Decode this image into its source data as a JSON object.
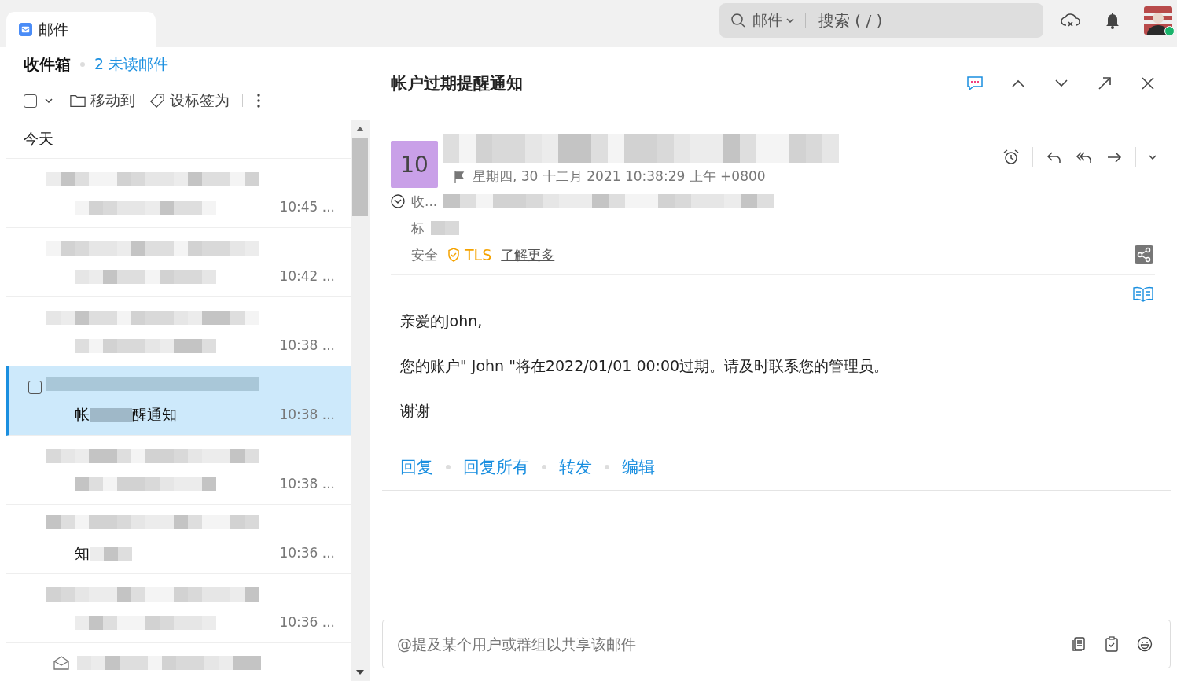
{
  "app_tab": {
    "label": "邮件"
  },
  "search": {
    "scope": "邮件",
    "placeholder": "搜索 ( / )"
  },
  "user": {
    "online": true
  },
  "folder": {
    "title": "收件箱",
    "unread": "2 未读邮件"
  },
  "toolbar": {
    "select_all_checked": false,
    "move": "移动到",
    "tag": "设标签为"
  },
  "list": {
    "group": "今天",
    "rows": [
      {
        "time": "10:45 ...",
        "selected": false,
        "checked": false
      },
      {
        "time": "10:42 ...",
        "selected": false,
        "checked": false
      },
      {
        "time": "10:38 ...",
        "selected": false,
        "checked": false
      },
      {
        "time": "10:38 ...",
        "selected": true,
        "checked": false,
        "fragments": [
          "帐",
          "醒通知"
        ]
      },
      {
        "time": "10:38 ...",
        "selected": false,
        "checked": false
      },
      {
        "time": "10:36 ...",
        "selected": false,
        "checked": false,
        "fragments": [
          "知"
        ]
      },
      {
        "time": "10:36 ...",
        "selected": false,
        "checked": false
      }
    ]
  },
  "message": {
    "subject": "帐户过期提醒通知",
    "avatar_initials": "10",
    "date": "星期四, 30 十二月 2021 10:38:29 上午 +0800",
    "to_label": "收...",
    "tag_label": "标",
    "security_label": "安全",
    "tls": "TLS",
    "learn_more": "了解更多",
    "body": [
      "亲爱的John,",
      "您的账户\" John \"将在2022/01/01 00:00过期。请及时联系您的管理员。",
      "谢谢"
    ],
    "actions": [
      "回复",
      "回复所有",
      "转发",
      "编辑"
    ]
  },
  "comment": {
    "placeholder": "@提及某个用户或群组以共享该邮件"
  }
}
